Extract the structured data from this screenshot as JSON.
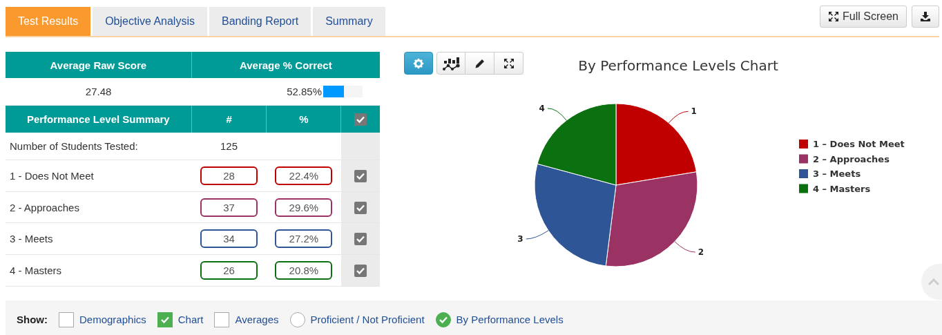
{
  "tabs": [
    {
      "label": "Test Results",
      "selected": true
    },
    {
      "label": "Objective Analysis",
      "selected": false
    },
    {
      "label": "Banding Report",
      "selected": false
    },
    {
      "label": "Summary",
      "selected": false
    }
  ],
  "header_buttons": [
    {
      "kind": "fullscreen",
      "label": "Full Screen"
    },
    {
      "kind": "download"
    }
  ],
  "averages": {
    "columns": [
      "Average Raw Score",
      "Average % Correct"
    ],
    "raw_score": "27.48",
    "percent_correct": "52.85%",
    "level": 0.5285
  },
  "performance_table": {
    "columns": [
      "Performance Level Summary",
      "#",
      "%"
    ],
    "all_checked": true,
    "students_tested": {
      "label": "Number of Students Tested:",
      "value": "125"
    },
    "rows": [
      {
        "label": "1 - Does Not Meet",
        "count": "28",
        "percent": "22.4%",
        "color": "#c00000",
        "checked": true
      },
      {
        "label": "2 - Approaches",
        "count": "37",
        "percent": "29.6%",
        "color": "#9b3264",
        "checked": true
      },
      {
        "label": "3 - Meets",
        "count": "34",
        "percent": "27.2%",
        "color": "#2e5596",
        "checked": true
      },
      {
        "label": "4 - Masters",
        "count": "26",
        "percent": "20.8%",
        "color": "#0b7010",
        "checked": true
      }
    ]
  },
  "chart_toolbar": [
    {
      "kind": "settings",
      "selected": true
    },
    {
      "kind": "chart_type",
      "selected": false
    },
    {
      "kind": "edit",
      "selected": false
    },
    {
      "kind": "expand",
      "selected": false
    }
  ],
  "chart": {
    "chart_data": {
      "type": "pie",
      "title": "By Performance Levels Chart",
      "categories": [
        "1",
        "2",
        "3",
        "4"
      ],
      "series": [
        {
          "values": [
            22.4,
            29.6,
            27.2,
            20.8
          ]
        }
      ]
    },
    "legend": [
      {
        "label": "1 – Does Not Meet",
        "color": "#c00000"
      },
      {
        "label": "2 – Approaches",
        "color": "#9b3264"
      },
      {
        "label": "3 – Meets",
        "color": "#2e5596"
      },
      {
        "label": "4 – Masters",
        "color": "#0b7010"
      }
    ]
  },
  "show_options": {
    "label": "Show:",
    "items": [
      {
        "kind": "checkbox",
        "label": "Demographics",
        "checked": false
      },
      {
        "kind": "checkbox",
        "label": "Chart",
        "checked": true
      },
      {
        "kind": "checkbox",
        "label": "Averages",
        "checked": false
      },
      {
        "kind": "radio",
        "label": "Proficient / Not Proficient",
        "checked": false
      },
      {
        "kind": "radio",
        "label": "By Performance Levels",
        "checked": true
      }
    ]
  }
}
